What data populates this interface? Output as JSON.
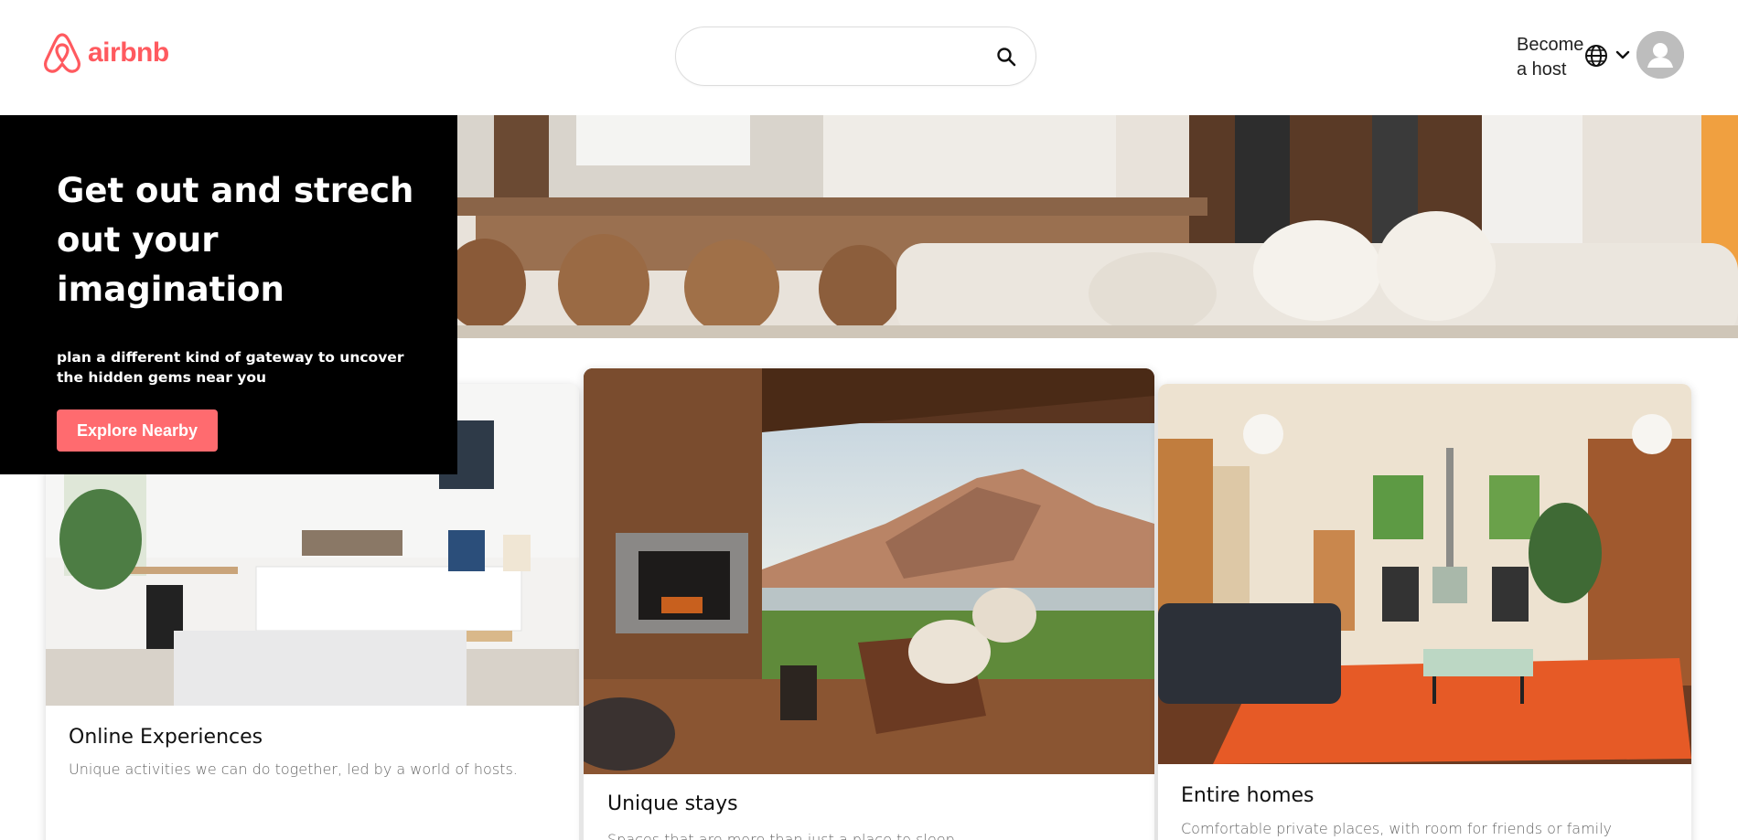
{
  "header": {
    "logo_text": "airbnb",
    "search": {
      "value": "",
      "placeholder": ""
    },
    "host_link": "Become a host",
    "icons": [
      "airbnb-logo-icon",
      "search-icon",
      "globe-icon",
      "chevron-down-icon",
      "user-avatar-icon"
    ]
  },
  "hero": {
    "title": "Get out and strech out your imagination",
    "subtitle": "plan a different kind of gateway to uncover the hidden gems near you",
    "button_label": "Explore Nearby"
  },
  "cards": [
    {
      "title": "Online Experiences",
      "description": "Unique activities we can do together, led by a world of hosts."
    },
    {
      "title": "Unique stays",
      "description": "Spaces that are more than just a place to sleep."
    },
    {
      "title": "Entire homes",
      "description": "Comfortable private places, with room for friends or family"
    }
  ],
  "colors": {
    "brand": "#ff5a5f",
    "button": "#ff6b6f",
    "hero_panel": "#000000",
    "text_dark": "#222222",
    "text_muted": "#666666"
  }
}
